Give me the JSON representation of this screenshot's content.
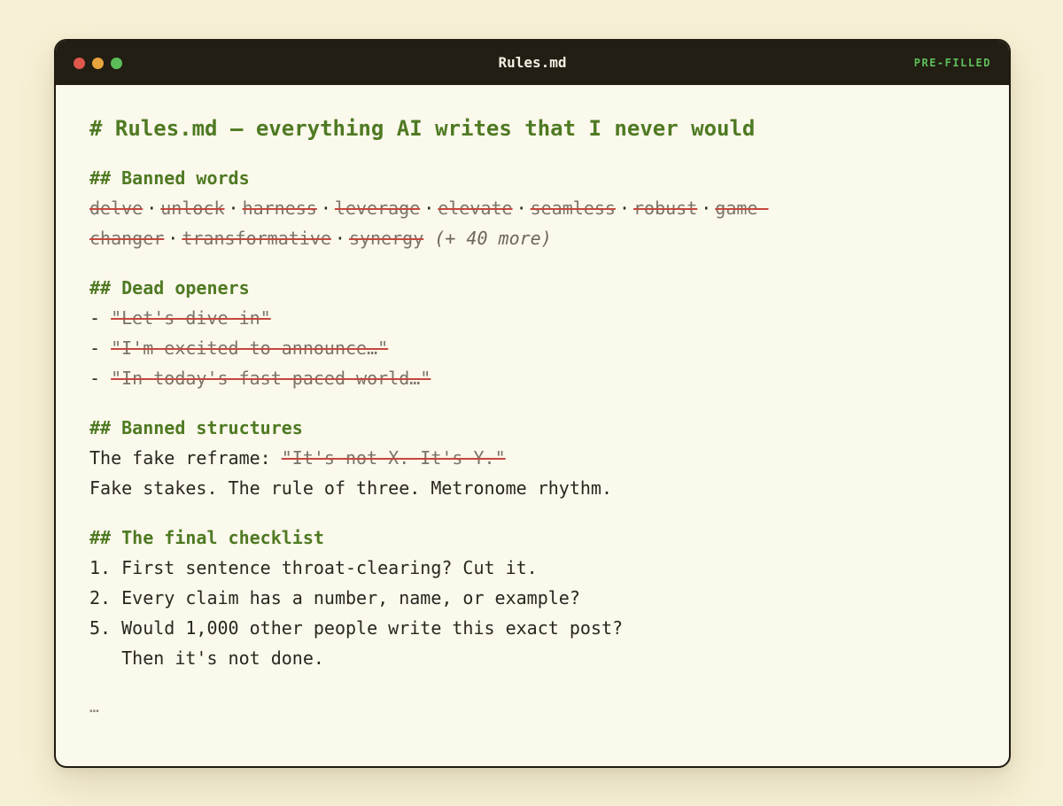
{
  "window": {
    "title": "Rules.md",
    "badge": "PRE-FILLED",
    "controls": [
      "close",
      "minimize",
      "maximize"
    ]
  },
  "doc": {
    "h1": "# Rules.md — everything AI writes that I never would",
    "banned_words": {
      "heading": "## Banned words",
      "separator": "·",
      "words_line1": [
        "delve",
        "unlock",
        "harness",
        "leverage",
        "elevate",
        "seamless",
        "robust",
        "game-"
      ],
      "words_line2": [
        "changer",
        "transformative",
        "synergy"
      ],
      "more": "(+ 40 more)"
    },
    "dead_openers": {
      "heading": "## Dead openers",
      "bullet": "-",
      "items": [
        "\"Let's dive in\"",
        "\"I'm excited to announce…\"",
        "\"In today's fast-paced world…\""
      ]
    },
    "banned_structures": {
      "heading": "## Banned structures",
      "reframe_label": "The fake reframe:",
      "reframe_struck": "\"It's not X. It's Y.\"",
      "line2": "Fake stakes. The rule of three. Metronome rhythm."
    },
    "checklist": {
      "heading": "## The final checklist",
      "items": [
        "1. First sentence throat-clearing? Cut it.",
        "2. Every claim has a number, name, or example?",
        "5. Would 1,000 other people write this exact post?",
        "   Then it's not done."
      ]
    },
    "ellipsis": "…"
  }
}
